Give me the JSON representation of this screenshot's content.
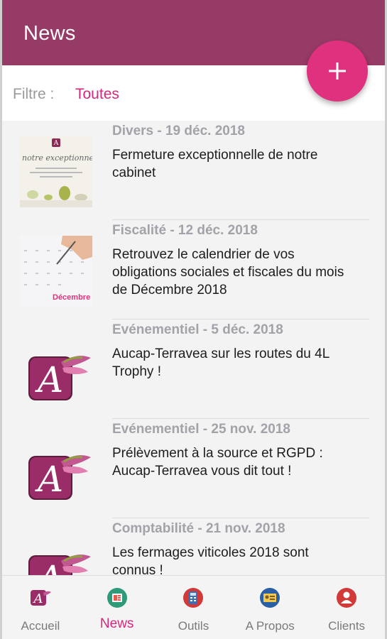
{
  "app_bar": {
    "title": "News"
  },
  "filter": {
    "label": "Filtre :",
    "value": "Toutes"
  },
  "fab": {
    "icon": "plus-icon",
    "color": "#e0317f"
  },
  "colors": {
    "primary": "#963a66",
    "accent": "#d6287b"
  },
  "news": [
    {
      "meta": "Divers - 19 déc. 2018",
      "title": "Fermeture exceptionnelle de notre cabinet",
      "thumb": "closure-notice-thumbnail",
      "thumb_text": "notre exceptionne"
    },
    {
      "meta": "Fiscalité - 12 déc. 2018",
      "title": "Retrouvez le calendrier de vos obligations sociales et fiscales du mois de Décembre 2018",
      "thumb": "calendar-thumbnail",
      "thumb_text": "Décembre"
    },
    {
      "meta": "Evénementiel - 5 déc. 2018",
      "title": "Aucap-Terravea sur les routes du 4L Trophy !",
      "thumb": "aucap-logo"
    },
    {
      "meta": "Evénementiel - 25 nov. 2018",
      "title": "Prélèvement à la source et RGPD : Aucap-Terravea vous dit tout !",
      "thumb": "aucap-logo"
    },
    {
      "meta": "Comptabilité - 21 nov. 2018",
      "title": "Les fermages viticoles 2018 sont connus !",
      "thumb": "aucap-logo"
    }
  ],
  "bottom_nav": [
    {
      "label": "Accueil",
      "icon": "aucap-logo-icon",
      "active": false
    },
    {
      "label": "News",
      "icon": "news-icon",
      "active": true
    },
    {
      "label": "Outils",
      "icon": "calculator-icon",
      "active": false
    },
    {
      "label": "A Propos",
      "icon": "id-card-icon",
      "active": false
    },
    {
      "label": "Clients",
      "icon": "user-icon",
      "active": false
    }
  ]
}
